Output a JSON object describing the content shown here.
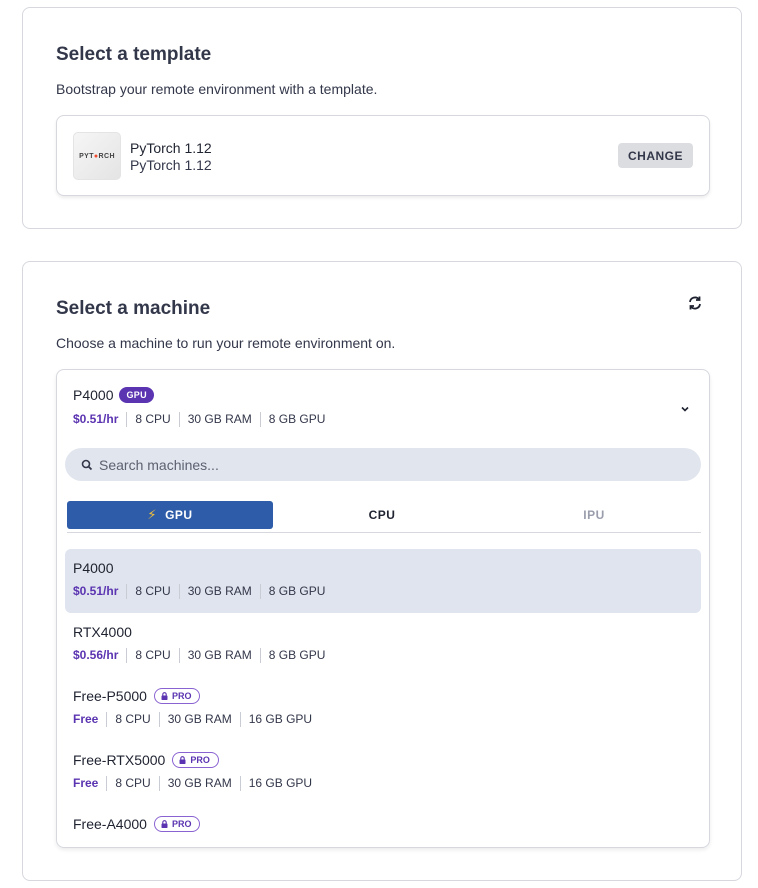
{
  "template_section": {
    "title": "Select a template",
    "subtitle": "Bootstrap your remote environment with a template.",
    "selected": {
      "logo_text_a": "PYT",
      "logo_text_b": "RCH",
      "name": "PyTorch 1.12",
      "description": "PyTorch 1.12"
    },
    "change_label": "CHANGE"
  },
  "machine_section": {
    "title": "Select a machine",
    "subtitle": "Choose a machine to run your remote environment on.",
    "selected": {
      "name": "P4000",
      "badge": "GPU",
      "price": "$0.51/hr",
      "cpu": "8 CPU",
      "ram": "30 GB RAM",
      "gpu": "8 GB GPU"
    },
    "search": {
      "placeholder": "Search machines..."
    },
    "tabs": [
      {
        "label": "GPU",
        "icon": "bolt-icon",
        "active": true
      },
      {
        "label": "CPU",
        "active": false
      },
      {
        "label": "IPU",
        "active": false
      }
    ],
    "items": [
      {
        "name": "P4000",
        "price": "$0.51/hr",
        "cpu": "8 CPU",
        "ram": "30 GB RAM",
        "gpu": "8 GB GPU",
        "selected": true
      },
      {
        "name": "RTX4000",
        "price": "$0.56/hr",
        "cpu": "8 CPU",
        "ram": "30 GB RAM",
        "gpu": "8 GB GPU"
      },
      {
        "name": "Free-P5000",
        "badge": "PRO",
        "price": "Free",
        "cpu": "8 CPU",
        "ram": "30 GB RAM",
        "gpu": "16 GB GPU"
      },
      {
        "name": "Free-RTX5000",
        "badge": "PRO",
        "price": "Free",
        "cpu": "8 CPU",
        "ram": "30 GB RAM",
        "gpu": "16 GB GPU"
      },
      {
        "name": "Free-A4000",
        "badge": "PRO"
      }
    ]
  },
  "colors": {
    "accent_purple": "#5b34b1",
    "tab_active": "#2e5ca8",
    "selected_row": "#dfe4ee"
  }
}
